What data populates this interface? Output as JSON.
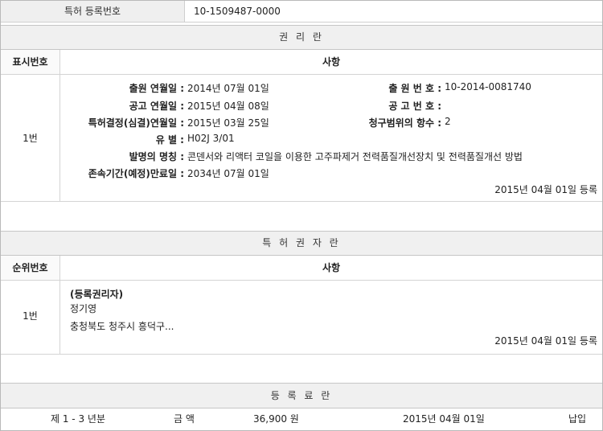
{
  "reg": {
    "label": "특허 등록번호",
    "number": "10-1509487-0000"
  },
  "rights_section": {
    "title": "권 리 란",
    "col_index": "표시번호",
    "col_matter": "사항",
    "row_index": "1번",
    "fields": {
      "filing_date_label": "출원 연월일 :",
      "filing_date": "2014년 07월 01일",
      "filing_no_label": "출 원 번 호 :",
      "filing_no": "10-2014-0081740",
      "pub_date_label": "공고 연월일 :",
      "pub_date": "2015년 04월 08일",
      "pub_no_label": "공 고 번 호 :",
      "pub_no": "",
      "decision_label": "특허결정(심결)연월일 :",
      "decision_date": "2015년 03월 25일",
      "claims_label": "청구범위의 항수 :",
      "claims": "2",
      "class_label": "유 별 :",
      "class": "H02J 3/01",
      "title_label": "발명의 명칭 :",
      "title": "콘덴서와 리액터 코일을 이용한 고주파제거 전력품질개선장치 및 전력품질개선 방법",
      "expiry_label": "존속기간(예정)만료일 :",
      "expiry": "2034년 07월 01일"
    },
    "reg_note": "2015년 04월 01일 등록"
  },
  "holder_section": {
    "title": "특 허 권 자 란",
    "col_index": "순위번호",
    "col_matter": "사항",
    "row_index": "1번",
    "role": "(등록권리자)",
    "name": "정기영",
    "address": "충청북도 청주시 흥덕구...",
    "reg_note": "2015년 04월 01일 등록"
  },
  "fee_section": {
    "title": "등 록 료 란",
    "period": "제 1 - 3 년분",
    "amount_label": "금 액",
    "amount": "36,900 원",
    "date": "2015년 04월 01일",
    "status": "납입"
  }
}
